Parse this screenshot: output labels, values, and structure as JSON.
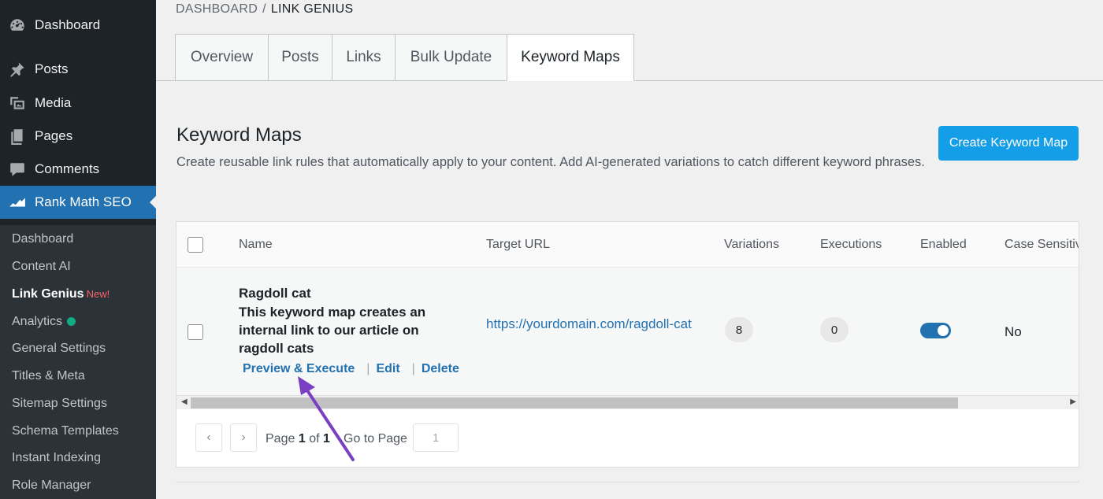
{
  "sidebar": {
    "top_items": [
      {
        "label": "Dashboard",
        "icon": "dashboard-icon"
      },
      {
        "label": "Posts",
        "icon": "pin-icon"
      },
      {
        "label": "Media",
        "icon": "media-icon"
      },
      {
        "label": "Pages",
        "icon": "pages-icon"
      },
      {
        "label": "Comments",
        "icon": "comment-icon"
      },
      {
        "label": "Rank Math SEO",
        "icon": "rank-math-icon"
      }
    ],
    "submenu": [
      {
        "label": "Dashboard"
      },
      {
        "label": "Content AI"
      },
      {
        "label": "Link Genius",
        "badge": "New!"
      },
      {
        "label": "Analytics"
      },
      {
        "label": "General Settings"
      },
      {
        "label": "Titles & Meta"
      },
      {
        "label": "Sitemap Settings"
      },
      {
        "label": "Schema Templates"
      },
      {
        "label": "Instant Indexing"
      },
      {
        "label": "Role Manager"
      }
    ],
    "active_color": "#2271b1",
    "analytics_status_color": "#10ac84"
  },
  "breadcrumb": {
    "parent": "DASHBOARD",
    "separator": "/",
    "current": "LINK GENIUS"
  },
  "tabs": [
    {
      "label": "Overview"
    },
    {
      "label": "Posts"
    },
    {
      "label": "Links"
    },
    {
      "label": "Bulk Update"
    },
    {
      "label": "Keyword Maps"
    }
  ],
  "header": {
    "title": "Keyword Maps",
    "description": "Create reusable link rules that automatically apply to your content. Add AI-generated variations to catch different keyword phrases.",
    "create_button": "Create Keyword Map"
  },
  "table": {
    "columns": [
      "Name",
      "Target URL",
      "Variations",
      "Executions",
      "Enabled",
      "Case Sensitiv"
    ],
    "rows": [
      {
        "name": "Ragdoll cat",
        "description": "This keyword map creates an internal link to our article on ragdoll cats",
        "actions": {
          "preview": "Preview & Execute",
          "edit": "Edit",
          "delete": "Delete",
          "separator": "|"
        },
        "target_url": "https://yourdomain.com/ragdoll-cat",
        "variations": "8",
        "executions": "0",
        "enabled": true,
        "case_sensitive": "No"
      }
    ]
  },
  "pagination": {
    "prev": "‹",
    "next": "›",
    "page_label": "Page",
    "current_page": "1",
    "of_label": "of",
    "total_pages": "1",
    "goto_label": "Go to Page",
    "goto_value": "1"
  },
  "annotation_color": "#7b3fc4"
}
